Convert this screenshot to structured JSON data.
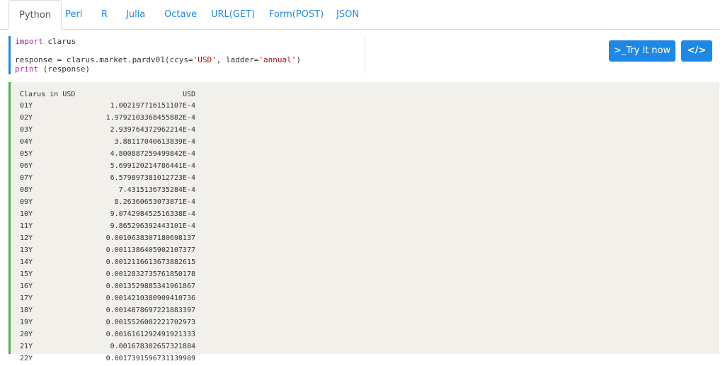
{
  "tabs": [
    {
      "label": "Python",
      "active": true
    },
    {
      "label": "Perl",
      "active": false
    },
    {
      "label": "R",
      "active": false
    },
    {
      "label": "Julia",
      "active": false
    },
    {
      "label": "Octave",
      "active": false
    },
    {
      "label": "URL(GET)",
      "active": false
    },
    {
      "label": "Form(POST)",
      "active": false
    },
    {
      "label": "JSON",
      "active": false
    }
  ],
  "code": {
    "line1_keyword": "import",
    "line1_rest": " clarus",
    "line2_prefix": "response = clarus.market.pardv01(ccys=",
    "line2_str1": "'USD'",
    "line2_mid": ", ladder=",
    "line2_str2": "'annual'",
    "line2_suffix": ")",
    "line3_keyword": "print",
    "line3_rest": " (response)"
  },
  "buttons": {
    "try_label": ">_Try it now",
    "code_label": "</>"
  },
  "output": {
    "header_label": "Clarus in USD",
    "header_value": "USD",
    "rows": [
      {
        "tenor": "01Y",
        "value": "1.002197716151107E-4"
      },
      {
        "tenor": "02Y",
        "value": "1.9792103368455882E-4"
      },
      {
        "tenor": "03Y",
        "value": "2.939764372962214E-4"
      },
      {
        "tenor": "04Y",
        "value": "3.88117040613839E-4"
      },
      {
        "tenor": "05Y",
        "value": "4.800887259499842E-4"
      },
      {
        "tenor": "06Y",
        "value": "5.699120214786441E-4"
      },
      {
        "tenor": "07Y",
        "value": "6.579897381012723E-4"
      },
      {
        "tenor": "08Y",
        "value": "7.4315136735284E-4"
      },
      {
        "tenor": "09Y",
        "value": "8.26360653073871E-4"
      },
      {
        "tenor": "10Y",
        "value": "9.074298452516338E-4"
      },
      {
        "tenor": "11Y",
        "value": "9.865296392443101E-4"
      },
      {
        "tenor": "12Y",
        "value": "0.0010638307180698137"
      },
      {
        "tenor": "13Y",
        "value": "0.0011386405902107377"
      },
      {
        "tenor": "14Y",
        "value": "0.0012116613673882615"
      },
      {
        "tenor": "15Y",
        "value": "0.0012832735761850178"
      },
      {
        "tenor": "16Y",
        "value": "0.0013529885341961867"
      },
      {
        "tenor": "17Y",
        "value": "0.0014210380909410736"
      },
      {
        "tenor": "18Y",
        "value": "0.0014878697221883397"
      },
      {
        "tenor": "19Y",
        "value": "0.0015526002221702973"
      },
      {
        "tenor": "20Y",
        "value": "0.0016161292491921333"
      },
      {
        "tenor": "21Y",
        "value": "0.001678302657321884"
      },
      {
        "tenor": "22Y",
        "value": "0.0017391596731139989"
      }
    ]
  },
  "colors": {
    "accent": "#1e88e5",
    "output_border": "#4caf50",
    "output_bg": "#f2f0eb"
  }
}
